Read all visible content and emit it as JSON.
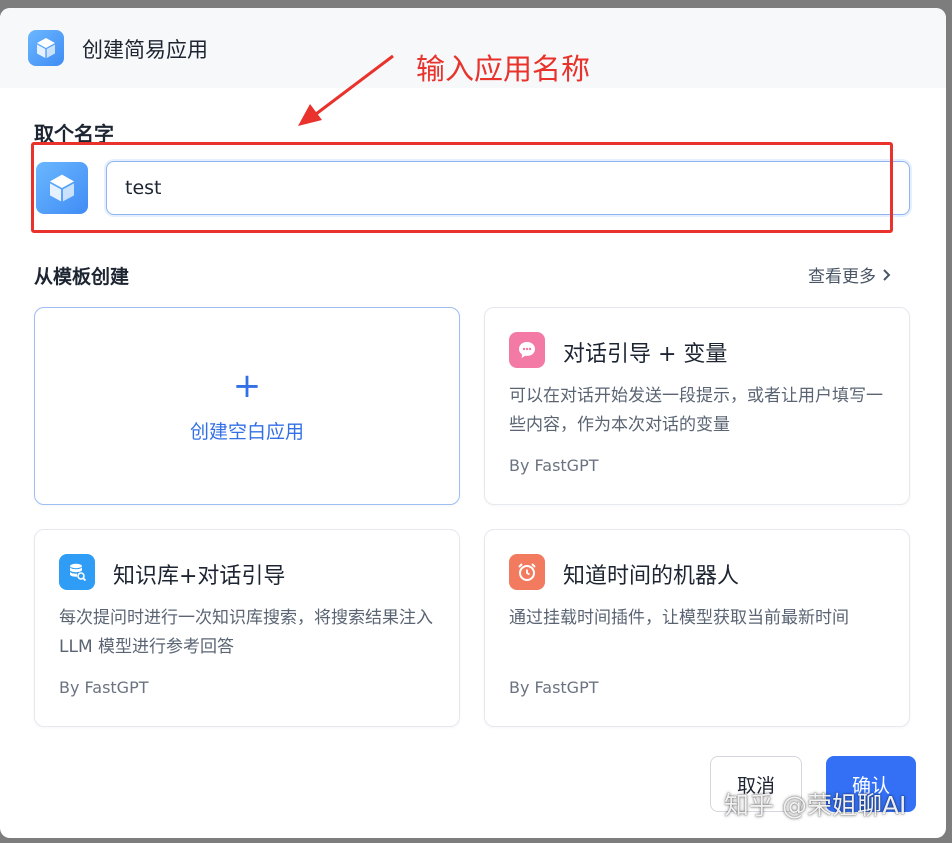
{
  "header": {
    "title": "创建简易应用",
    "icon": "cube-icon"
  },
  "annotation": {
    "text": "输入应用名称",
    "color": "#e8322b"
  },
  "name_section": {
    "label": "取个名字",
    "avatar_icon": "cube-icon",
    "input_value": "test"
  },
  "templates": {
    "label": "从模板创建",
    "more_label": "查看更多",
    "blank": {
      "plus": "+",
      "label": "创建空白应用"
    },
    "cards": [
      {
        "title": "对话引导 + 变量",
        "description": "可以在对话开始发送一段提示，或者让用户填写一些内容，作为本次对话的变量",
        "author": "By FastGPT",
        "icon": "chat-bubble-icon",
        "icon_color": "#f27aa5"
      },
      {
        "title": "知识库+对话引导",
        "description": "每次提问时进行一次知识库搜索，将搜索结果注入 LLM 模型进行参考回答",
        "author": "By FastGPT",
        "icon": "database-search-icon",
        "icon_color": "#2f9cf5"
      },
      {
        "title": "知道时间的机器人",
        "description": "通过挂载时间插件，让模型获取当前最新时间",
        "author": "By FastGPT",
        "icon": "alarm-clock-icon",
        "icon_color": "#f27a5e"
      }
    ]
  },
  "footer": {
    "cancel_label": "取消",
    "confirm_label": "确认"
  },
  "watermark": "知乎 @荣姐聊AI",
  "colors": {
    "primary": "#3370f6",
    "annotation_red": "#e8322b"
  }
}
